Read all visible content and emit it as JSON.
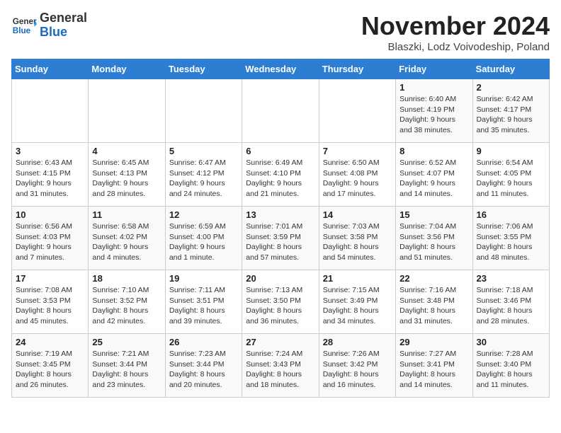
{
  "header": {
    "logo_general": "General",
    "logo_blue": "Blue",
    "title": "November 2024",
    "subtitle": "Blaszki, Lodz Voivodeship, Poland"
  },
  "weekdays": [
    "Sunday",
    "Monday",
    "Tuesday",
    "Wednesday",
    "Thursday",
    "Friday",
    "Saturday"
  ],
  "weeks": [
    [
      {
        "day": "",
        "text": ""
      },
      {
        "day": "",
        "text": ""
      },
      {
        "day": "",
        "text": ""
      },
      {
        "day": "",
        "text": ""
      },
      {
        "day": "",
        "text": ""
      },
      {
        "day": "1",
        "text": "Sunrise: 6:40 AM\nSunset: 4:19 PM\nDaylight: 9 hours\nand 38 minutes."
      },
      {
        "day": "2",
        "text": "Sunrise: 6:42 AM\nSunset: 4:17 PM\nDaylight: 9 hours\nand 35 minutes."
      }
    ],
    [
      {
        "day": "3",
        "text": "Sunrise: 6:43 AM\nSunset: 4:15 PM\nDaylight: 9 hours\nand 31 minutes."
      },
      {
        "day": "4",
        "text": "Sunrise: 6:45 AM\nSunset: 4:13 PM\nDaylight: 9 hours\nand 28 minutes."
      },
      {
        "day": "5",
        "text": "Sunrise: 6:47 AM\nSunset: 4:12 PM\nDaylight: 9 hours\nand 24 minutes."
      },
      {
        "day": "6",
        "text": "Sunrise: 6:49 AM\nSunset: 4:10 PM\nDaylight: 9 hours\nand 21 minutes."
      },
      {
        "day": "7",
        "text": "Sunrise: 6:50 AM\nSunset: 4:08 PM\nDaylight: 9 hours\nand 17 minutes."
      },
      {
        "day": "8",
        "text": "Sunrise: 6:52 AM\nSunset: 4:07 PM\nDaylight: 9 hours\nand 14 minutes."
      },
      {
        "day": "9",
        "text": "Sunrise: 6:54 AM\nSunset: 4:05 PM\nDaylight: 9 hours\nand 11 minutes."
      }
    ],
    [
      {
        "day": "10",
        "text": "Sunrise: 6:56 AM\nSunset: 4:03 PM\nDaylight: 9 hours\nand 7 minutes."
      },
      {
        "day": "11",
        "text": "Sunrise: 6:58 AM\nSunset: 4:02 PM\nDaylight: 9 hours\nand 4 minutes."
      },
      {
        "day": "12",
        "text": "Sunrise: 6:59 AM\nSunset: 4:00 PM\nDaylight: 9 hours\nand 1 minute."
      },
      {
        "day": "13",
        "text": "Sunrise: 7:01 AM\nSunset: 3:59 PM\nDaylight: 8 hours\nand 57 minutes."
      },
      {
        "day": "14",
        "text": "Sunrise: 7:03 AM\nSunset: 3:58 PM\nDaylight: 8 hours\nand 54 minutes."
      },
      {
        "day": "15",
        "text": "Sunrise: 7:04 AM\nSunset: 3:56 PM\nDaylight: 8 hours\nand 51 minutes."
      },
      {
        "day": "16",
        "text": "Sunrise: 7:06 AM\nSunset: 3:55 PM\nDaylight: 8 hours\nand 48 minutes."
      }
    ],
    [
      {
        "day": "17",
        "text": "Sunrise: 7:08 AM\nSunset: 3:53 PM\nDaylight: 8 hours\nand 45 minutes."
      },
      {
        "day": "18",
        "text": "Sunrise: 7:10 AM\nSunset: 3:52 PM\nDaylight: 8 hours\nand 42 minutes."
      },
      {
        "day": "19",
        "text": "Sunrise: 7:11 AM\nSunset: 3:51 PM\nDaylight: 8 hours\nand 39 minutes."
      },
      {
        "day": "20",
        "text": "Sunrise: 7:13 AM\nSunset: 3:50 PM\nDaylight: 8 hours\nand 36 minutes."
      },
      {
        "day": "21",
        "text": "Sunrise: 7:15 AM\nSunset: 3:49 PM\nDaylight: 8 hours\nand 34 minutes."
      },
      {
        "day": "22",
        "text": "Sunrise: 7:16 AM\nSunset: 3:48 PM\nDaylight: 8 hours\nand 31 minutes."
      },
      {
        "day": "23",
        "text": "Sunrise: 7:18 AM\nSunset: 3:46 PM\nDaylight: 8 hours\nand 28 minutes."
      }
    ],
    [
      {
        "day": "24",
        "text": "Sunrise: 7:19 AM\nSunset: 3:45 PM\nDaylight: 8 hours\nand 26 minutes."
      },
      {
        "day": "25",
        "text": "Sunrise: 7:21 AM\nSunset: 3:44 PM\nDaylight: 8 hours\nand 23 minutes."
      },
      {
        "day": "26",
        "text": "Sunrise: 7:23 AM\nSunset: 3:44 PM\nDaylight: 8 hours\nand 20 minutes."
      },
      {
        "day": "27",
        "text": "Sunrise: 7:24 AM\nSunset: 3:43 PM\nDaylight: 8 hours\nand 18 minutes."
      },
      {
        "day": "28",
        "text": "Sunrise: 7:26 AM\nSunset: 3:42 PM\nDaylight: 8 hours\nand 16 minutes."
      },
      {
        "day": "29",
        "text": "Sunrise: 7:27 AM\nSunset: 3:41 PM\nDaylight: 8 hours\nand 14 minutes."
      },
      {
        "day": "30",
        "text": "Sunrise: 7:28 AM\nSunset: 3:40 PM\nDaylight: 8 hours\nand 11 minutes."
      }
    ]
  ]
}
